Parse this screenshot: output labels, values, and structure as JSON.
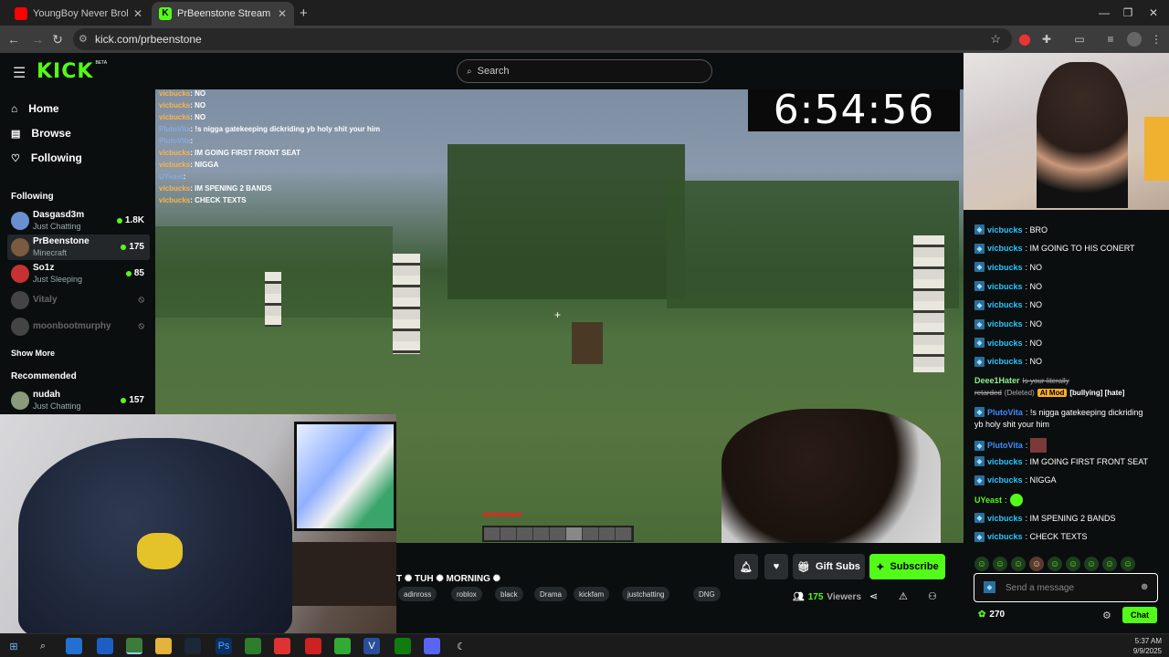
{
  "browser": {
    "tabs": [
      {
        "title": "YoungBoy Never Broke Again -",
        "active": false,
        "favicon_color": "#ff0000"
      },
      {
        "title": "PrBeenstone Stream - Watc",
        "active": true,
        "favicon_color": "#53fc18"
      }
    ],
    "url": "kick.com/prbeenstone"
  },
  "header": {
    "logo": "KICK",
    "logo_badge": "BETA",
    "search_placeholder": "Search"
  },
  "sidebar": {
    "nav": [
      {
        "label": "Home",
        "icon": "home-icon"
      },
      {
        "label": "Browse",
        "icon": "browse-icon"
      },
      {
        "label": "Following",
        "icon": "heart-icon"
      }
    ],
    "following_title": "Following",
    "following": [
      {
        "name": "Dasgasd3m",
        "category": "Just Chatting",
        "viewers": "1.8K",
        "live": true,
        "avatar": "#6a8fd0"
      },
      {
        "name": "PrBeenstone",
        "category": "Minecraft",
        "viewers": "175",
        "live": true,
        "avatar": "#7a5a40"
      },
      {
        "name": "So1z",
        "category": "Just Sleeping",
        "viewers": "85",
        "live": true,
        "avatar": "#c43232"
      },
      {
        "name": "Vitaly",
        "category": "",
        "viewers": "",
        "live": false,
        "avatar": "#444"
      },
      {
        "name": "moonbootmurphy",
        "category": "",
        "viewers": "",
        "live": false,
        "avatar": "#444"
      }
    ],
    "show_more": "Show More",
    "recommended_title": "Recommended",
    "recommended": [
      {
        "name": "nudah",
        "category": "Just Chatting",
        "viewers": "157",
        "live": true,
        "avatar": "#8a9a7a"
      }
    ]
  },
  "video": {
    "timer": "6:54:56",
    "overlay_chat": [
      {
        "user": "vicbucks",
        "text": ": NO"
      },
      {
        "user": "vicbucks",
        "text": ": NO"
      },
      {
        "user": "vicbucks",
        "text": ": NO"
      },
      {
        "user": "PlutoVita",
        "text": ": !s nigga gatekeeping dickriding yb holy shit your him"
      },
      {
        "user": "PlutoVita",
        "text": ":"
      },
      {
        "user": "vicbucks",
        "text": ": IM GOING FIRST FRONT SEAT"
      },
      {
        "user": "vicbucks",
        "text": ": NIGGA"
      },
      {
        "user": "UYeast",
        "text": ":"
      },
      {
        "user": "vicbucks",
        "text": ": IM SPENING 2 BANDS"
      },
      {
        "user": "vicbucks",
        "text": ": CHECK TEXTS"
      }
    ]
  },
  "stream_info": {
    "title_fragment": "T ✺ TUH ✺ MORNING ✺",
    "tags": [
      "adinross",
      "roblox",
      "black",
      "Drama",
      "kickfam",
      "justchatting",
      "DNG"
    ],
    "gift_subs": "Gift Subs",
    "subscribe": "Subscribe",
    "viewers_count": "175",
    "viewers_label": "Viewers"
  },
  "chat": {
    "messages": [
      {
        "user": "vicbucks",
        "text": ": BRO"
      },
      {
        "user": "vicbucks",
        "text": ": IM GOING TO HIS CONERT"
      },
      {
        "user": "vicbucks",
        "text": ": NO"
      },
      {
        "user": "vicbucks",
        "text": ": NO"
      },
      {
        "user": "vicbucks",
        "text": ": NO"
      },
      {
        "user": "vicbucks",
        "text": ": NO"
      },
      {
        "user": "vicbucks",
        "text": ": NO"
      },
      {
        "user": "vicbucks",
        "text": ": NO"
      }
    ],
    "deleted_user": "Deee1Hater",
    "deleted_text_1": "Is your literally",
    "deleted_text_2": "retarded",
    "deleted_label": "(Deleted)",
    "ai_mod": "AI Mod",
    "mod_tags": "[bullying] [hate]",
    "pluto_user": "PlutoVita",
    "pluto_text_1": ": !s nigga gatekeeping dickriding",
    "pluto_text_2": "yb holy shit your him",
    "pluto_user_2": "PlutoVita",
    "pluto_text_3": ":",
    "after": [
      {
        "user": "vicbucks",
        "text": ": IM GOING FIRST FRONT SEAT",
        "color": "b"
      },
      {
        "user": "vicbucks",
        "text": ": NIGGA",
        "color": "b"
      },
      {
        "user": "UYeast",
        "text": ":",
        "color": "g"
      },
      {
        "user": "vicbucks",
        "text": ": IM SPENING 2 BANDS",
        "color": "b"
      },
      {
        "user": "vicbucks",
        "text": ": CHECK TEXTS",
        "color": "b"
      }
    ],
    "input_placeholder": "Send a message",
    "points": "270",
    "chat_button": "Chat"
  },
  "taskbar": {
    "time": "5:37 AM",
    "date": "9/9/2025"
  },
  "colors": {
    "kick_green": "#53fc18",
    "bg": "#0b0e0f",
    "chat_user": "#27c6ff"
  }
}
